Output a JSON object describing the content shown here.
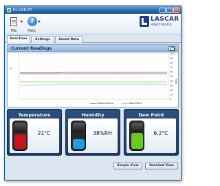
{
  "window": {
    "title": "EL-USB-RT"
  },
  "toolbar": {
    "file_label": "File",
    "help_label": "Help"
  },
  "logo": {
    "name": "LASCAR",
    "sub": "electronics"
  },
  "tabs": [
    {
      "label": "Real-Time",
      "active": true
    },
    {
      "label": "Settings",
      "active": false
    },
    {
      "label": "Saved Data",
      "active": false
    }
  ],
  "readings": {
    "title": "Current Readings",
    "left_axis_label": "°C",
    "right_axis_label": "%RH",
    "right_ticks": [
      "100",
      "90",
      "80",
      "70",
      "60",
      "50",
      "40",
      "30",
      "20",
      "10",
      "0"
    ],
    "legend": [
      "Temperature",
      "Dew Point"
    ]
  },
  "chart_data": {
    "type": "line",
    "left_axis": {
      "label": "°C"
    },
    "right_axis": {
      "label": "%RH",
      "ticks": [
        100,
        90,
        80,
        70,
        60,
        50,
        40,
        30,
        20,
        10,
        0
      ],
      "ylim": [
        0,
        100
      ]
    },
    "grid": true,
    "series": [
      {
        "name": "Temperature",
        "color": "#8a8a8a",
        "axis": "right",
        "values": [
          58,
          58,
          58,
          58,
          59,
          59,
          59,
          59,
          59,
          59,
          59,
          59,
          59,
          59
        ]
      },
      {
        "color": "#c070a0",
        "axis": "right",
        "values": [
          56,
          56,
          56,
          56,
          56,
          56,
          56,
          56,
          56,
          56,
          56,
          56,
          56,
          56
        ]
      },
      {
        "color": "#a6d36a",
        "axis": "right",
        "values": [
          38,
          38,
          38,
          38,
          38,
          38,
          38,
          38,
          38,
          38,
          38,
          38,
          38,
          38
        ]
      },
      {
        "color": "#9ad3ee",
        "axis": "right",
        "values": [
          30,
          31,
          32,
          33,
          33,
          33,
          33,
          33,
          33,
          33,
          33,
          33,
          33,
          33
        ]
      }
    ]
  },
  "cards": [
    {
      "title": "Temperature",
      "value": "21°C",
      "color": "#c8151b",
      "level": 0.55
    },
    {
      "title": "Humidity",
      "value": "38%RH",
      "color": "#1f9ed8",
      "level": 0.38
    },
    {
      "title": "Dew Point",
      "value": "6.2°C",
      "color": "#6cc624",
      "level": 0.6
    }
  ],
  "views": {
    "simple_label": "Simple View",
    "detailed_label": "Detailed View"
  }
}
